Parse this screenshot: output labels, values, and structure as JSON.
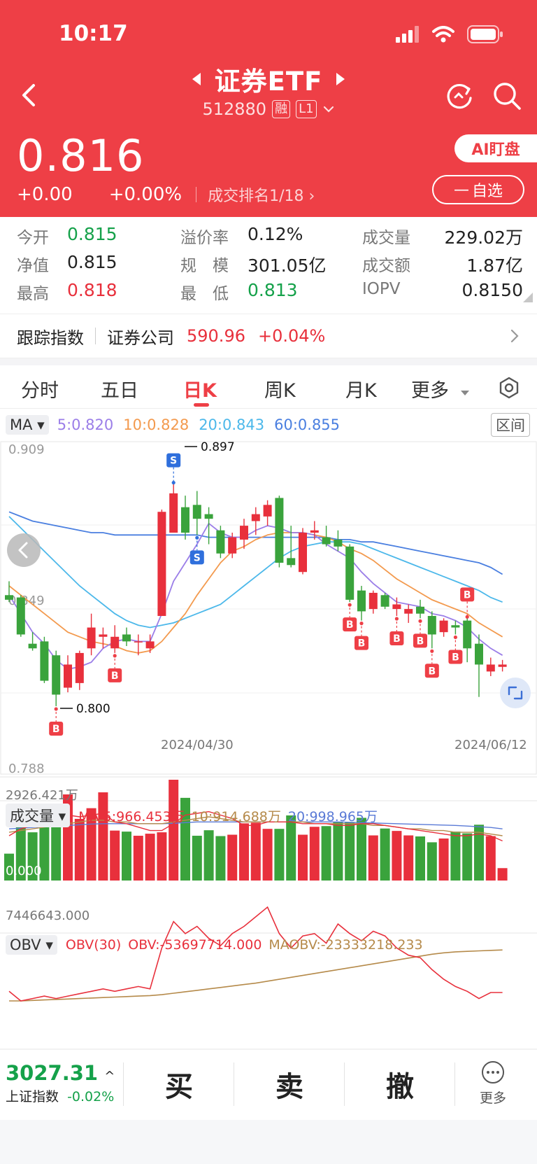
{
  "status": {
    "time": "10:17"
  },
  "header": {
    "title": "证券ETF",
    "code": "512880",
    "tag_margin": "融",
    "tag_level": "L1",
    "price": "0.816",
    "change": "+0.00",
    "change_pct": "+0.00%",
    "rank": "成交排名1/18",
    "ai_button": "AI盯盘",
    "fav_button": "自选",
    "bg_color": "#ee3f46"
  },
  "quote": {
    "open_label": "今开",
    "open_value": "0.815",
    "premium_label": "溢价率",
    "premium_value": "0.12%",
    "volume_label": "成交量",
    "volume_value": "229.02万",
    "nav_label": "净值",
    "nav_value": "0.815",
    "scale_label": "规　模",
    "scale_value": "301.05亿",
    "amount_label": "成交额",
    "amount_value": "1.87亿",
    "high_label": "最高",
    "high_value": "0.818",
    "low_label": "最　低",
    "low_value": "0.813",
    "iopv_label": "IOPV",
    "iopv_value": "0.8150"
  },
  "tracking": {
    "label": "跟踪指数",
    "index_name": "证券公司",
    "index_value": "590.96",
    "index_change": "+0.04%"
  },
  "tabs": [
    "分时",
    "五日",
    "日K",
    "周K",
    "月K",
    "更多"
  ],
  "active_tab": "日K",
  "ma": {
    "chip": "MA",
    "ma5": "5:0.820",
    "ma10": "10:0.828",
    "ma20": "20:0.843",
    "ma60": "60:0.855",
    "range_button": "区间",
    "colors": {
      "ma5": "#9b7ee8",
      "ma10": "#f39a4e",
      "ma20": "#4cb8ea",
      "ma60": "#4a7fe0"
    }
  },
  "kchart": {
    "y_top": "0.909",
    "y_mid": "0.849",
    "y_bottom": "0.788",
    "high_mark": "0.897",
    "low_mark": "0.800",
    "date_left": "2024/04/30",
    "date_right": "2024/06/12",
    "buy_marker": "B",
    "sell_marker": "S"
  },
  "volume": {
    "chip": "成交量",
    "ma5": "MA 5:966.453万",
    "ma10": "10:914.688万",
    "ma20": "20:998.965万",
    "max_label": "2926.421万",
    "min_label": "0.000"
  },
  "obv": {
    "chip": "OBV",
    "period": "OBV(30)",
    "obv": "OBV:-53697714.000",
    "maobv": "MAOBV:-23333218.233",
    "max_label": "7446643.000"
  },
  "bottom": {
    "index_value": "3027.31",
    "index_name": "上证指数",
    "index_change": "-0.02%",
    "buy": "买",
    "sell": "卖",
    "cancel": "撤",
    "more": "更多"
  },
  "chart_data": {
    "type": "candlestick",
    "date_labels": [
      "2024/04/30",
      "2024/06/12"
    ],
    "ylim": [
      0.788,
      0.909
    ],
    "annotations": {
      "high": 0.897,
      "low": 0.8
    },
    "ohlc": [
      {
        "o": 0.846,
        "h": 0.852,
        "l": 0.843,
        "c": 0.844
      },
      {
        "o": 0.845,
        "h": 0.846,
        "l": 0.828,
        "c": 0.829
      },
      {
        "o": 0.825,
        "h": 0.83,
        "l": 0.822,
        "c": 0.823
      },
      {
        "o": 0.826,
        "h": 0.828,
        "l": 0.808,
        "c": 0.809
      },
      {
        "o": 0.82,
        "h": 0.822,
        "l": 0.798,
        "c": 0.803
      },
      {
        "o": 0.806,
        "h": 0.82,
        "l": 0.804,
        "c": 0.816
      },
      {
        "o": 0.808,
        "h": 0.822,
        "l": 0.805,
        "c": 0.821
      },
      {
        "o": 0.823,
        "h": 0.838,
        "l": 0.82,
        "c": 0.832
      },
      {
        "o": 0.828,
        "h": 0.832,
        "l": 0.823,
        "c": 0.829
      },
      {
        "o": 0.823,
        "h": 0.833,
        "l": 0.821,
        "c": 0.828
      },
      {
        "o": 0.829,
        "h": 0.832,
        "l": 0.824,
        "c": 0.826
      },
      {
        "o": 0.826,
        "h": 0.829,
        "l": 0.82,
        "c": 0.826
      },
      {
        "o": 0.823,
        "h": 0.829,
        "l": 0.821,
        "c": 0.826
      },
      {
        "o": 0.837,
        "h": 0.883,
        "l": 0.837,
        "c": 0.882
      },
      {
        "o": 0.873,
        "h": 0.894,
        "l": 0.873,
        "c": 0.89
      },
      {
        "o": 0.884,
        "h": 0.889,
        "l": 0.87,
        "c": 0.873
      },
      {
        "o": 0.885,
        "h": 0.891,
        "l": 0.872,
        "c": 0.879
      },
      {
        "o": 0.881,
        "h": 0.884,
        "l": 0.868,
        "c": 0.879
      },
      {
        "o": 0.874,
        "h": 0.876,
        "l": 0.862,
        "c": 0.864
      },
      {
        "o": 0.864,
        "h": 0.873,
        "l": 0.862,
        "c": 0.871
      },
      {
        "o": 0.87,
        "h": 0.879,
        "l": 0.866,
        "c": 0.876
      },
      {
        "o": 0.878,
        "h": 0.884,
        "l": 0.872,
        "c": 0.881
      },
      {
        "o": 0.88,
        "h": 0.887,
        "l": 0.876,
        "c": 0.885
      },
      {
        "o": 0.888,
        "h": 0.889,
        "l": 0.858,
        "c": 0.86
      },
      {
        "o": 0.862,
        "h": 0.876,
        "l": 0.858,
        "c": 0.859
      },
      {
        "o": 0.856,
        "h": 0.875,
        "l": 0.855,
        "c": 0.873
      },
      {
        "o": 0.873,
        "h": 0.878,
        "l": 0.87,
        "c": 0.874
      },
      {
        "o": 0.871,
        "h": 0.876,
        "l": 0.867,
        "c": 0.868
      },
      {
        "o": 0.87,
        "h": 0.874,
        "l": 0.865,
        "c": 0.867
      },
      {
        "o": 0.867,
        "h": 0.868,
        "l": 0.843,
        "c": 0.844
      },
      {
        "o": 0.848,
        "h": 0.85,
        "l": 0.835,
        "c": 0.839
      },
      {
        "o": 0.84,
        "h": 0.848,
        "l": 0.838,
        "c": 0.847
      },
      {
        "o": 0.846,
        "h": 0.847,
        "l": 0.84,
        "c": 0.841
      },
      {
        "o": 0.84,
        "h": 0.845,
        "l": 0.837,
        "c": 0.842
      },
      {
        "o": 0.838,
        "h": 0.842,
        "l": 0.834,
        "c": 0.84
      },
      {
        "o": 0.841,
        "h": 0.844,
        "l": 0.836,
        "c": 0.838
      },
      {
        "o": 0.837,
        "h": 0.839,
        "l": 0.823,
        "c": 0.829
      },
      {
        "o": 0.83,
        "h": 0.836,
        "l": 0.828,
        "c": 0.835
      },
      {
        "o": 0.833,
        "h": 0.835,
        "l": 0.829,
        "c": 0.832
      },
      {
        "o": 0.835,
        "h": 0.836,
        "l": 0.817,
        "c": 0.823
      },
      {
        "o": 0.825,
        "h": 0.829,
        "l": 0.802,
        "c": 0.816
      },
      {
        "o": 0.813,
        "h": 0.819,
        "l": 0.811,
        "c": 0.816
      },
      {
        "o": 0.815,
        "h": 0.818,
        "l": 0.813,
        "c": 0.816
      }
    ],
    "ma5": [
      0.846,
      0.838,
      0.83,
      0.825,
      0.818,
      0.814,
      0.815,
      0.817,
      0.823,
      0.826,
      0.827,
      0.826,
      0.826,
      0.838,
      0.852,
      0.86,
      0.868,
      0.877,
      0.873,
      0.871,
      0.871,
      0.874,
      0.876,
      0.875,
      0.873,
      0.873,
      0.872,
      0.868,
      0.865,
      0.862,
      0.856,
      0.851,
      0.847,
      0.843,
      0.842,
      0.841,
      0.838,
      0.837,
      0.835,
      0.832,
      0.827,
      0.823,
      0.82
    ],
    "ma10": [
      0.85,
      0.846,
      0.842,
      0.838,
      0.834,
      0.83,
      0.828,
      0.826,
      0.825,
      0.824,
      0.822,
      0.821,
      0.822,
      0.826,
      0.832,
      0.838,
      0.846,
      0.853,
      0.86,
      0.865,
      0.867,
      0.87,
      0.872,
      0.873,
      0.873,
      0.873,
      0.872,
      0.871,
      0.869,
      0.866,
      0.864,
      0.861,
      0.857,
      0.853,
      0.85,
      0.847,
      0.844,
      0.842,
      0.84,
      0.838,
      0.834,
      0.831,
      0.828
    ],
    "ma20": [
      0.88,
      0.875,
      0.87,
      0.865,
      0.86,
      0.855,
      0.85,
      0.846,
      0.842,
      0.838,
      0.835,
      0.833,
      0.832,
      0.833,
      0.834,
      0.836,
      0.838,
      0.84,
      0.842,
      0.846,
      0.85,
      0.854,
      0.858,
      0.862,
      0.865,
      0.867,
      0.868,
      0.869,
      0.869,
      0.869,
      0.868,
      0.866,
      0.864,
      0.862,
      0.86,
      0.858,
      0.856,
      0.854,
      0.852,
      0.85,
      0.848,
      0.845,
      0.843
    ],
    "ma60": [
      0.882,
      0.88,
      0.878,
      0.877,
      0.876,
      0.875,
      0.874,
      0.873,
      0.873,
      0.872,
      0.872,
      0.872,
      0.872,
      0.872,
      0.872,
      0.872,
      0.872,
      0.871,
      0.871,
      0.871,
      0.871,
      0.871,
      0.871,
      0.871,
      0.871,
      0.871,
      0.871,
      0.871,
      0.87,
      0.87,
      0.869,
      0.869,
      0.868,
      0.867,
      0.866,
      0.865,
      0.864,
      0.863,
      0.862,
      0.861,
      0.86,
      0.858,
      0.855
    ],
    "buy_signals": [
      4,
      9,
      29,
      30,
      33,
      35,
      36,
      38,
      39
    ],
    "buy_signals_above": [
      39
    ],
    "sell_signals": [
      14,
      16
    ],
    "volume": [
      780,
      1990,
      1400,
      1600,
      1950,
      2500,
      1790,
      2100,
      2560,
      1450,
      1420,
      1300,
      1360,
      1400,
      2926,
      2400,
      1300,
      1460,
      1290,
      1330,
      1660,
      1680,
      1500,
      1500,
      1890,
      1330,
      1560,
      1580,
      1700,
      1690,
      1820,
      1310,
      1510,
      1440,
      1310,
      1280,
      1110,
      1220,
      1420,
      1370,
      1620,
      1290,
      360
    ],
    "volume_ma5": [
      1300,
      1500,
      1600,
      1650,
      1700,
      1900,
      1850,
      1900,
      1950,
      1700,
      1650,
      1550,
      1450,
      1450,
      1650,
      1900,
      1950,
      2000,
      1900,
      1800,
      1600,
      1600,
      1700,
      1700,
      1700,
      1650,
      1650,
      1650,
      1600,
      1600,
      1650,
      1650,
      1600,
      1550,
      1500,
      1450,
      1400,
      1350,
      1300,
      1300,
      1350,
      1300,
      1150
    ],
    "volume_ma10": [
      1400,
      1450,
      1500,
      1550,
      1600,
      1650,
      1700,
      1750,
      1750,
      1700,
      1700,
      1650,
      1650,
      1650,
      1700,
      1750,
      1800,
      1850,
      1800,
      1750,
      1700,
      1700,
      1700,
      1700,
      1700,
      1700,
      1650,
      1650,
      1650,
      1650,
      1650,
      1600,
      1600,
      1550,
      1500,
      1500,
      1450,
      1450,
      1400,
      1400,
      1400,
      1350,
      1300
    ],
    "volume_ma20": [
      1500,
      1520,
      1540,
      1560,
      1580,
      1600,
      1620,
      1640,
      1650,
      1650,
      1650,
      1650,
      1650,
      1650,
      1660,
      1680,
      1700,
      1700,
      1700,
      1700,
      1700,
      1700,
      1700,
      1700,
      1700,
      1700,
      1700,
      1700,
      1700,
      1690,
      1680,
      1670,
      1660,
      1650,
      1640,
      1630,
      1620,
      1610,
      1600,
      1580,
      1560,
      1540,
      1500
    ],
    "obv": [
      -120,
      -160,
      -150,
      -140,
      -150,
      -140,
      -130,
      -120,
      -110,
      -120,
      -110,
      -100,
      -110,
      60,
      170,
      120,
      150,
      100,
      70,
      120,
      150,
      190,
      230,
      120,
      60,
      110,
      120,
      80,
      160,
      120,
      90,
      130,
      110,
      60,
      30,
      20,
      -30,
      -70,
      -100,
      -120,
      -150,
      -125,
      -125
    ],
    "maobv": [
      -160,
      -160,
      -158,
      -156,
      -154,
      -152,
      -150,
      -148,
      -146,
      -144,
      -142,
      -140,
      -138,
      -134,
      -128,
      -122,
      -116,
      -110,
      -104,
      -98,
      -92,
      -86,
      -78,
      -70,
      -62,
      -54,
      -46,
      -38,
      -30,
      -22,
      -14,
      -6,
      2,
      10,
      18,
      26,
      34,
      40,
      44,
      46,
      48,
      50,
      52
    ]
  }
}
